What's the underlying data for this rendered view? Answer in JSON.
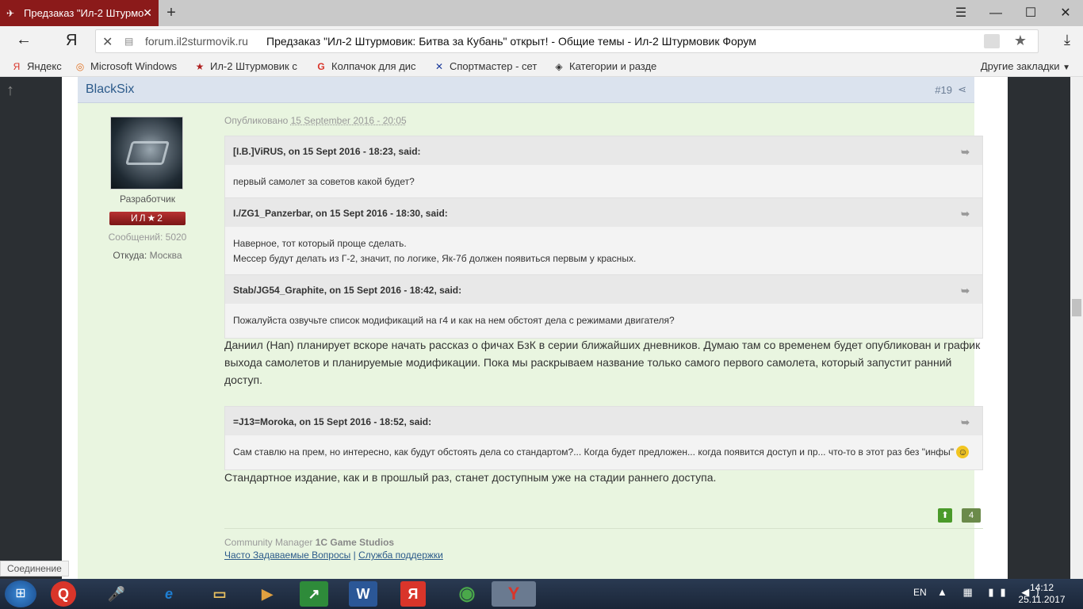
{
  "browser": {
    "tab_title": "Предзаказ \"Ил-2 Штурмо",
    "new_tab": "+",
    "window_controls": [
      "☰",
      "—",
      "☐",
      "✕"
    ],
    "yandex_logo": "Я",
    "url_domain": "forum.il2sturmovik.ru",
    "url_title": "Предзаказ \"Ил-2 Штурмовик: Битва за Кубань\" открыт! - Общие темы - Ил-2 Штурмовик Форум",
    "bookmarks": [
      {
        "label": "Яндекс",
        "icon": "Я"
      },
      {
        "label": "Microsoft Windows",
        "icon": "◎"
      },
      {
        "label": "Ил-2 Штурмовик с",
        "icon": "★"
      },
      {
        "label": "Колпачок для дис",
        "icon": "G"
      },
      {
        "label": "Спортмастер - сет",
        "icon": "✕"
      },
      {
        "label": "Категории и разде",
        "icon": "◈"
      }
    ],
    "other_bookmarks": "Другие закладки",
    "status_text": "Соединение"
  },
  "post": {
    "author": "BlackSix",
    "post_number": "#19",
    "role": "Разработчик",
    "rank_badge": "ИЛ★2",
    "post_count_label": "Сообщений: 5020",
    "location_label": "Откуда: ",
    "location_value": "Москва",
    "published_label": "Опубликовано ",
    "published_date": "15 September 2016 - 20:05",
    "quotes": [
      {
        "header": "[I.B.]ViRUS, on 15 Sept 2016 - 18:23, said:",
        "lines": [
          "первый самолет за советов какой будет?"
        ]
      },
      {
        "header": "I./ZG1_Panzerbar, on 15 Sept 2016 - 18:30, said:",
        "lines": [
          "Наверное, тот который проще сделать.",
          "Мессер будут делать из Г-2, значит, по логике, Як-7б должен появиться первым у красных."
        ]
      },
      {
        "header": "Stab/JG54_Graphite, on 15 Sept 2016 - 18:42, said:",
        "lines": [
          "Пожалуйста озвучьте список модификаций на г4 и как на нем обстоят дела с режимами двигателя?"
        ]
      }
    ],
    "reply1": "Даниил (Han) планирует вскоре начать рассказ о фичах БзК в серии ближайших дневников. Думаю там со временем будет опубликован и график выхода самолетов и планируемые модификации. Пока мы раскрываем название только самого первого самолета, который запустит ранний доступ.",
    "quote4": {
      "header": "=J13=Moroka, on 15 Sept 2016 - 18:52, said:",
      "line": "Сам ставлю на прем, но интересно, как будут обстоять дела со стандартом?... Когда будет предложен... когда появится доступ и пр... что-то в этот раз без \"инфы\" "
    },
    "smiley": "☺",
    "reply2": "Стандартное издание, как и в прошлый раз, станет доступным уже на стадии раннего доступа.",
    "vote_up": "⬆",
    "vote_count": "4",
    "sig_prefix": "Community Manager ",
    "sig_company": "1C Game Studios",
    "sig_link1": "Часто Задаваемые Вопросы",
    "sig_sep": " | ",
    "sig_link2": "Служба поддержки"
  },
  "taskbar": {
    "apps": [
      {
        "name": "search",
        "glyph": "Q",
        "bg": "#d9352a"
      },
      {
        "name": "alice",
        "glyph": "🎤",
        "bg": "#d9352a"
      },
      {
        "name": "ie",
        "glyph": "e",
        "bg": "#1e7fd4"
      },
      {
        "name": "explorer",
        "glyph": "▭",
        "bg": "#e8c060"
      },
      {
        "name": "media",
        "glyph": "▶",
        "bg": "#e0a040"
      },
      {
        "name": "finance",
        "glyph": "↗",
        "bg": "#2e8b3a"
      },
      {
        "name": "word",
        "glyph": "W",
        "bg": "#2b5797"
      },
      {
        "name": "yandex-app",
        "glyph": "Я",
        "bg": "#d9352a"
      },
      {
        "name": "chrome",
        "glyph": "◉",
        "bg": "#4a8a3a"
      },
      {
        "name": "yandex-browser",
        "glyph": "Y",
        "bg": "#d9352a"
      }
    ],
    "lang": "EN",
    "tray": "▲ ▦ ▮▮ ◀)",
    "time": "14:12",
    "date": "25.11.2017"
  }
}
